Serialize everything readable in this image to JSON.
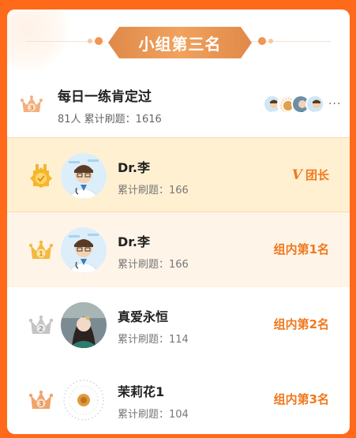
{
  "header": {
    "title": "小组第三名"
  },
  "group": {
    "rank": "3",
    "name": "每日一练肯定过",
    "stats": "81人 累计刷题：1616",
    "more": "···"
  },
  "members": [
    {
      "name": "Dr.李",
      "stat": "累计刷题：166",
      "badge": "团长",
      "badge_mark": "V"
    },
    {
      "name": "Dr.李",
      "stat": "累计刷题：166",
      "rank_label": "组内第1名",
      "rank": "1"
    },
    {
      "name": "真爱永恒",
      "stat": "累计刷题：114",
      "rank_label": "组内第2名",
      "rank": "2"
    },
    {
      "name": "茉莉花1",
      "stat": "累计刷题：104",
      "rank_label": "组内第3名",
      "rank": "3"
    }
  ],
  "colors": {
    "accent": "#f0781e",
    "background": "#ff6a1a",
    "leader_row": "#fff0d2",
    "first_row": "#fff4e8",
    "gold": "#f5b842",
    "silver": "#c4c4c4",
    "bronze": "#f0a36a"
  }
}
